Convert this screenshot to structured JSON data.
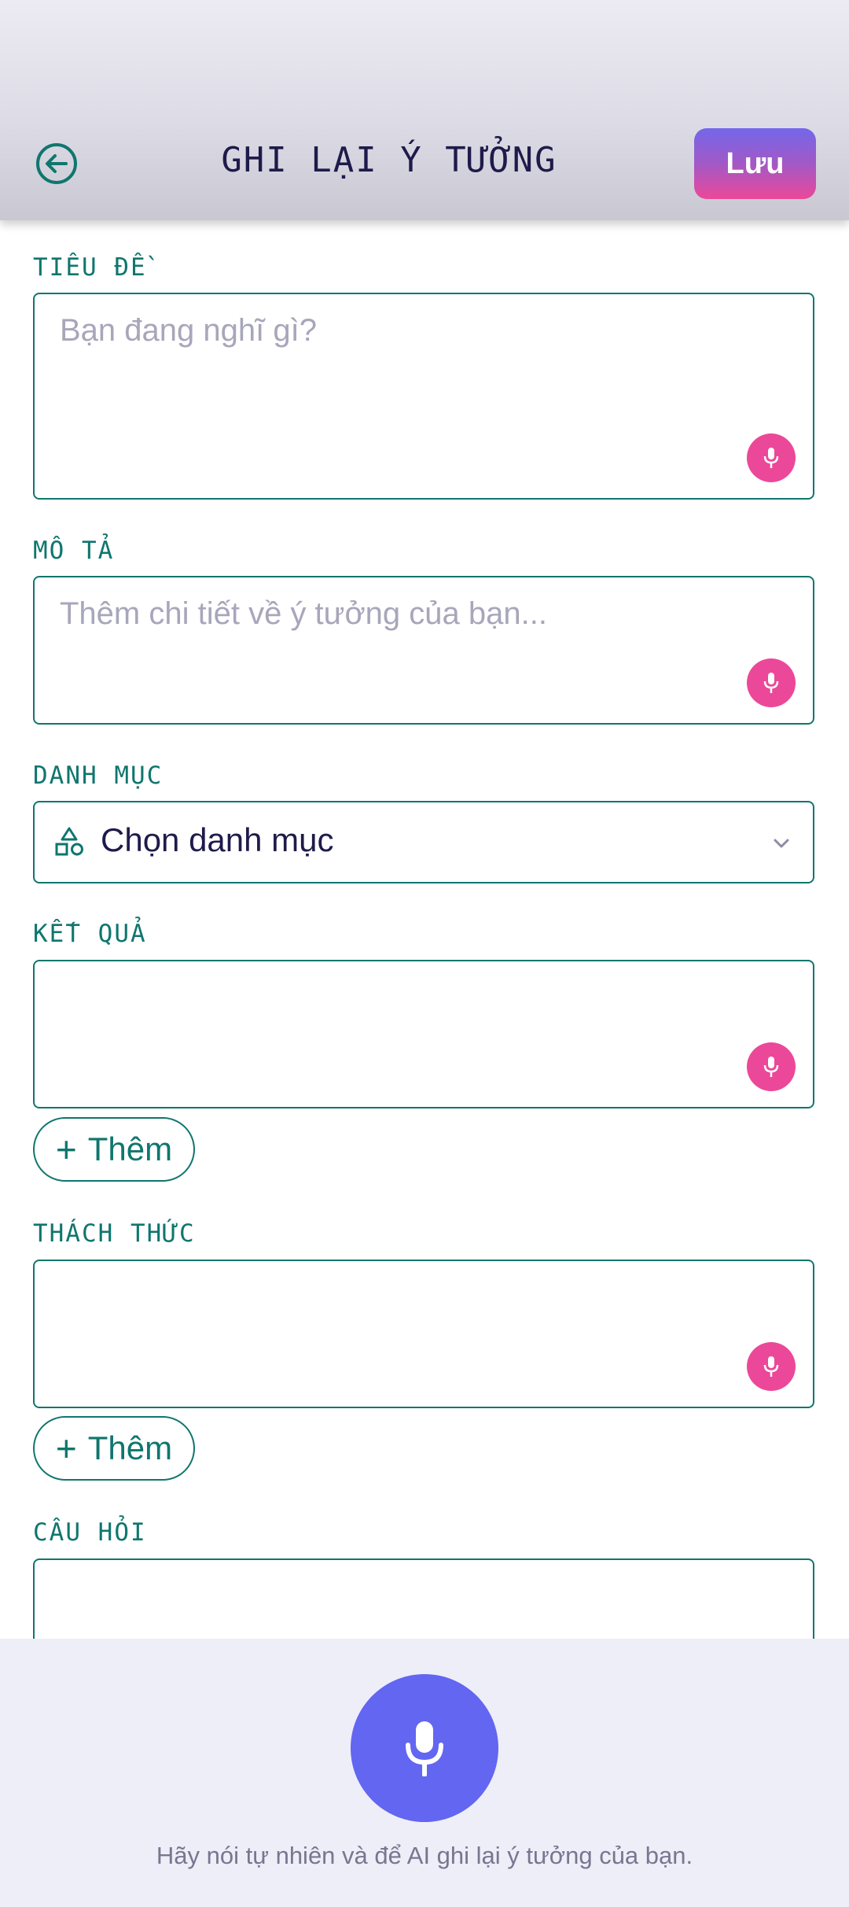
{
  "header": {
    "title": "GHI LẠI Ý TƯỞNG",
    "save_label": "Lưu",
    "back_icon": "arrow-left-circle-icon"
  },
  "form": {
    "title": {
      "label": "TIÊU ĐỀ",
      "placeholder": "Bạn đang nghĩ gì?"
    },
    "description": {
      "label": "MÔ TẢ",
      "placeholder": "Thêm chi tiết về ý tưởng của bạn..."
    },
    "category": {
      "label": "DANH MỤC",
      "value": "Chọn danh mục",
      "icon": "shapes-icon"
    },
    "results": {
      "label": "KẾT QUẢ",
      "add_label": "Thêm"
    },
    "challenges": {
      "label": "THÁCH THỨC",
      "add_label": "Thêm"
    },
    "questions": {
      "label": "CÂU HỎI"
    }
  },
  "voice": {
    "hint": "Hãy nói tự nhiên và để AI ghi lại ý tưởng của bạn."
  },
  "colors": {
    "accent_teal": "#0f766e",
    "mic_pink": "#ec4899",
    "voice_indigo": "#6366f1",
    "title_navy": "#1e1b4b"
  }
}
